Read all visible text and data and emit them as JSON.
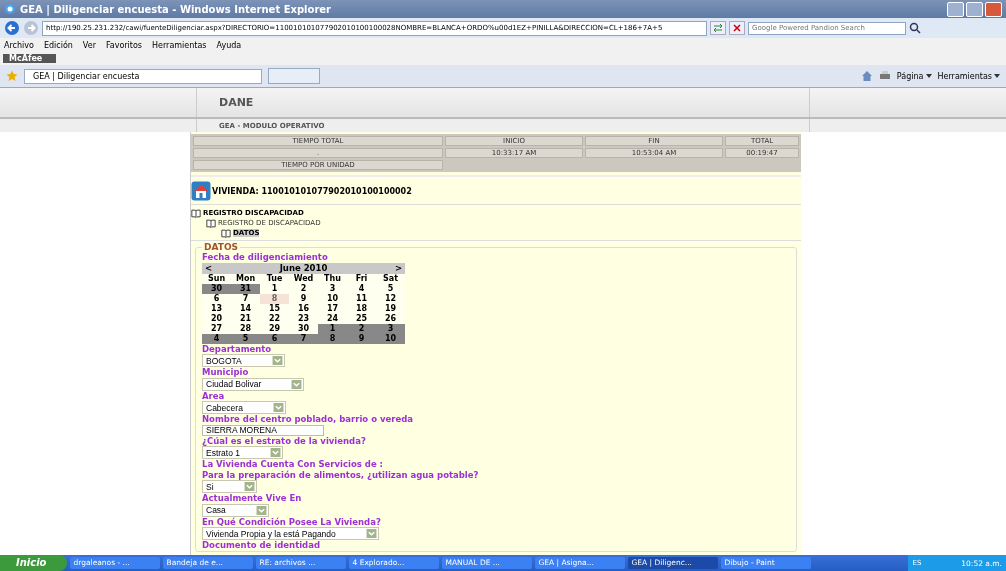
{
  "window": {
    "title": "GEA | Diligenciar encuesta - Windows Internet Explorer"
  },
  "address": {
    "url": "http://190.25.231.232/cawi/fuenteDiligenciar.aspx?DIRECTORIO=110010101077902010100100028NOMBRE=BLANCA+ORDO%u00d1EZ+PINILLA&DIRECCION=CL+186+7A+5",
    "search_placeholder": "Google Powered Pandion Search"
  },
  "menu": [
    "Archivo",
    "Edición",
    "Ver",
    "Favoritos",
    "Herramientas",
    "Ayuda"
  ],
  "toolbar": {
    "mcafee": "McAfee",
    "tab": "GEA | Diligenciar encuesta",
    "pagina": "Página",
    "herramientas": "Herramientas"
  },
  "header": {
    "title": "DANE",
    "subtitle": "GEA - MODULO OPERATIVO"
  },
  "timer": {
    "total_label": "TIEMPO TOTAL",
    "total_value": ".",
    "unit_label": "TIEMPO POR UNIDAD",
    "columns": [
      {
        "head": "INICIO",
        "value": "10:33:17 AM"
      },
      {
        "head": "FIN",
        "value": "10:53:04 AM"
      },
      {
        "head": "TOTAL",
        "value": "00:19:47"
      }
    ]
  },
  "vivienda": "VIVIENDA: 110010101077902010100100002",
  "tree": [
    {
      "label": "REGISTRO DISCAPACIDAD",
      "selected": false,
      "children": [
        {
          "label": "REGISTRO DE DISCAPACIDAD",
          "selected": false,
          "children": [
            {
              "label": "DATOS",
              "selected": true
            }
          ]
        }
      ]
    }
  ],
  "section": "DATOS",
  "date_label": "Fecha de diligenciamiento",
  "calendar": {
    "prev": "<",
    "month": "June 2010",
    "next": ">",
    "weekdays": [
      "Sun",
      "Mon",
      "Tue",
      "Wed",
      "Thu",
      "Fri",
      "Sat"
    ],
    "weeks": [
      [
        {
          "day": "30",
          "other": true,
          "selected": false
        },
        {
          "day": "31",
          "other": true,
          "selected": false
        },
        {
          "day": "1",
          "other": false,
          "selected": false
        },
        {
          "day": "2",
          "other": false,
          "selected": false
        },
        {
          "day": "3",
          "other": false,
          "selected": false
        },
        {
          "day": "4",
          "other": false,
          "selected": false
        },
        {
          "day": "5",
          "other": false,
          "selected": false
        }
      ],
      [
        {
          "day": "6",
          "other": false,
          "selected": false
        },
        {
          "day": "7",
          "other": false,
          "selected": false
        },
        {
          "day": "8",
          "other": false,
          "selected": true
        },
        {
          "day": "9",
          "other": false,
          "selected": false
        },
        {
          "day": "10",
          "other": false,
          "selected": false
        },
        {
          "day": "11",
          "other": false,
          "selected": false
        },
        {
          "day": "12",
          "other": false,
          "selected": false
        }
      ],
      [
        {
          "day": "13",
          "other": false,
          "selected": false
        },
        {
          "day": "14",
          "other": false,
          "selected": false
        },
        {
          "day": "15",
          "other": false,
          "selected": false
        },
        {
          "day": "16",
          "other": false,
          "selected": false
        },
        {
          "day": "17",
          "other": false,
          "selected": false
        },
        {
          "day": "18",
          "other": false,
          "selected": false
        },
        {
          "day": "19",
          "other": false,
          "selected": false
        }
      ],
      [
        {
          "day": "20",
          "other": false,
          "selected": false
        },
        {
          "day": "21",
          "other": false,
          "selected": false
        },
        {
          "day": "22",
          "other": false,
          "selected": false
        },
        {
          "day": "23",
          "other": false,
          "selected": false
        },
        {
          "day": "24",
          "other": false,
          "selected": false
        },
        {
          "day": "25",
          "other": false,
          "selected": false
        },
        {
          "day": "26",
          "other": false,
          "selected": false
        }
      ],
      [
        {
          "day": "27",
          "other": false,
          "selected": false
        },
        {
          "day": "28",
          "other": false,
          "selected": false
        },
        {
          "day": "29",
          "other": false,
          "selected": false
        },
        {
          "day": "30",
          "other": false,
          "selected": false
        },
        {
          "day": "1",
          "other": true,
          "selected": false
        },
        {
          "day": "2",
          "other": true,
          "selected": false
        },
        {
          "day": "3",
          "other": true,
          "selected": false
        }
      ],
      [
        {
          "day": "4",
          "other": true,
          "selected": false
        },
        {
          "day": "5",
          "other": true,
          "selected": false
        },
        {
          "day": "6",
          "other": true,
          "selected": false
        },
        {
          "day": "7",
          "other": true,
          "selected": false
        },
        {
          "day": "8",
          "other": true,
          "selected": false
        },
        {
          "day": "9",
          "other": true,
          "selected": false
        },
        {
          "day": "10",
          "other": true,
          "selected": false
        }
      ]
    ]
  },
  "fields": [
    {
      "kind": "select",
      "label": "Departamento",
      "value": "BOGOTA"
    },
    {
      "kind": "select",
      "label": "Municipio",
      "value": "Ciudad Bolivar"
    },
    {
      "kind": "select",
      "label": "Area",
      "value": "Cabecera"
    },
    {
      "kind": "text",
      "label": "Nombre del centro poblado, barrio o vereda",
      "value": "SIERRA MORENA"
    },
    {
      "kind": "select",
      "label": "¿Cúal es el estrato de la vivienda?",
      "value": "Estrato 1"
    },
    {
      "kind": "heading",
      "label": "La Vivienda Cuenta Con Servicios de :"
    },
    {
      "kind": "select",
      "label": "Para la preparación de alimentos, ¿utilizan agua potable?",
      "value": "Si"
    },
    {
      "kind": "select",
      "label": "Actualmente Vive En",
      "value": "Casa"
    },
    {
      "kind": "select",
      "label": "En Qué Condición Posee La Vivienda?",
      "value": "Vivienda Propia y la está Pagando"
    },
    {
      "kind": "heading",
      "label": "Documento de identidad"
    }
  ],
  "taskbar": {
    "start": "Inicio",
    "items": [
      {
        "label": "drgaleanos - ...",
        "selected": false
      },
      {
        "label": "Bandeja de e...",
        "selected": false
      },
      {
        "label": "RE: archivos ...",
        "selected": false
      },
      {
        "label": "4 Explorado...",
        "selected": false
      },
      {
        "label": "MANUAL DE ...",
        "selected": false
      },
      {
        "label": "GEA | Asigna...",
        "selected": false
      },
      {
        "label": "GEA | Diligenc...",
        "selected": true
      },
      {
        "label": "Dibujo - Paint",
        "selected": false
      }
    ],
    "lang": "ES",
    "clock": "10:52 a.m."
  }
}
